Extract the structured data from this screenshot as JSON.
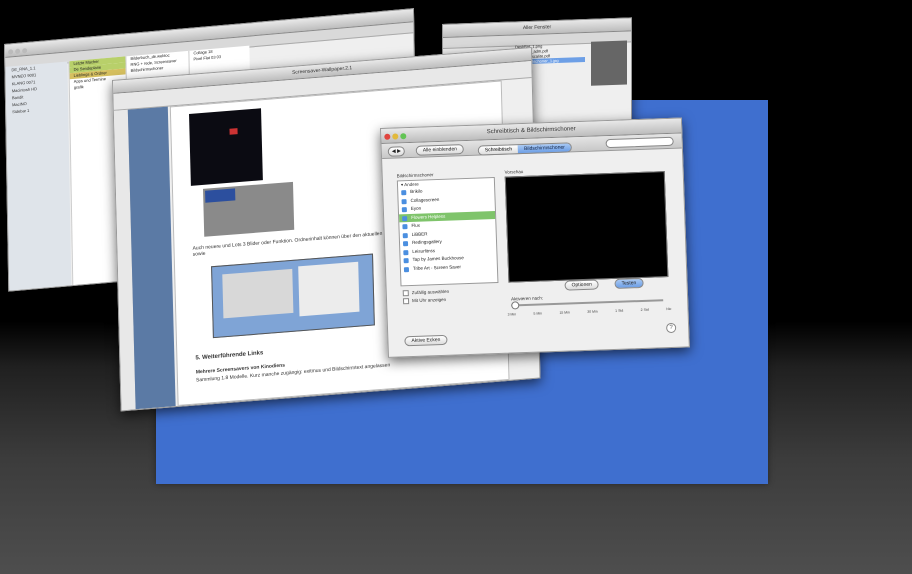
{
  "finder": {
    "sidebar": [
      "DE_RNA_1.1",
      "MVNEO 9001",
      "KLANG 0071",
      "Macintosh HD",
      "Bandit",
      "MacINO",
      "Sidebar 1"
    ],
    "col1": [
      "Letzte Macher",
      "De Sendeplane",
      "Lieblings & Ordner",
      "Apps und Termine",
      "grafik"
    ],
    "col2": [
      "Bilderbuch_de.webloc",
      "RNG + rede, Screensaver",
      "Bildschirmschoner"
    ],
    "col3": [
      "Collage 18",
      "Pixel Flat 03 03"
    ]
  },
  "document": {
    "title": "Screensaver-Wallpaper.2.1",
    "caption1": "Auch neuere und Lots 3 Blider oder Funktion. Ordnerinhalt können über den aktuellen Zustände eine einmaligen Bildschirmschoner, sowie",
    "heading": "5. Weiterführende Links",
    "link_title": "Mehrere Screensavers von Kinodiens",
    "link_sub": "Sammlung 1.8 Modelle. Kurz manche zugängig: exitmus und Bildschirmtext angelassen"
  },
  "prefs": {
    "title": "Schreibtisch & Bildschirmschoner",
    "show_all": "Alle einblenden",
    "search_placeholder": "",
    "tabs": [
      "Schreibtisch",
      "Bildschirmschoner"
    ],
    "list_label": "Bildschirmschoner",
    "preview_label": "Vorschau",
    "group": "▾ Andere",
    "items": [
      "Brikilo",
      "Collagescreen",
      "Eyon",
      "Flowers Helpless",
      "Flux",
      "LiBBER",
      "Redingsgallery",
      "Leisurfitnss",
      "Tap by James Buckhouse",
      "Tribe Art - Screen Saver"
    ],
    "selected_index": 3,
    "random_label": "Zufällig auswählen",
    "clock_label": "Mit Uhr anzeigen",
    "options_button": "Optionen",
    "test_button": "Testen",
    "start_after_label": "Aktivieren nach:",
    "ticks": [
      "3 Min",
      "5 Min",
      "15 Min",
      "30 Min",
      "1 Std",
      "2 Std",
      "Nie"
    ],
    "hot_corners_button": "Aktive Ecken",
    "help_icon": "?"
  },
  "topwin": {
    "title": "Aller Fenster",
    "items": [
      "DeskBot_1.png",
      "allernes: _adm.pdf",
      "einsitzt... scalite.pdf",
      "Bildschirmschoner_1.jpg"
    ]
  }
}
